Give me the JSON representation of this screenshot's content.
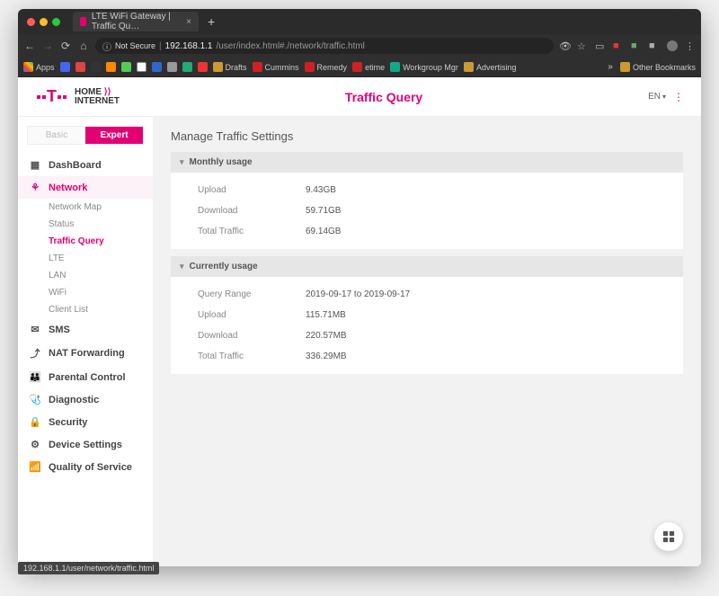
{
  "browser": {
    "tab_title": "LTE WiFi Gateway | Traffic Qu…",
    "url_prefix_insecure": "Not Secure",
    "url_host": "192.168.1.1",
    "url_path": "/user/index.html#./network/traffic.html",
    "bookmarks": {
      "apps": "Apps",
      "drafts": "Drafts",
      "cummins": "Cummins",
      "remedy": "Remedy",
      "etime": "etime",
      "workgroup": "Workgroup Mgr",
      "advertising": "Advertising",
      "other": "Other Bookmarks"
    },
    "status_text": "192.168.1.1/user/network/traffic.html"
  },
  "header": {
    "brand_line1": "HOME",
    "brand_line2": "INTERNET",
    "title": "Traffic Query",
    "lang": "EN"
  },
  "sidebar": {
    "mode_basic": "Basic",
    "mode_expert": "Expert",
    "items": [
      {
        "label": "DashBoard",
        "icon": "grid"
      },
      {
        "label": "Network",
        "icon": "network",
        "active": true,
        "subs": [
          {
            "label": "Network Map"
          },
          {
            "label": "Status"
          },
          {
            "label": "Traffic Query",
            "active": true
          },
          {
            "label": "LTE"
          },
          {
            "label": "LAN"
          },
          {
            "label": "WiFi"
          },
          {
            "label": "Client List"
          }
        ]
      },
      {
        "label": "SMS",
        "icon": "mail"
      },
      {
        "label": "NAT Forwarding",
        "icon": "share"
      },
      {
        "label": "Parental Control",
        "icon": "users"
      },
      {
        "label": "Diagnostic",
        "icon": "steth"
      },
      {
        "label": "Security",
        "icon": "lock"
      },
      {
        "label": "Device Settings",
        "icon": "gear"
      },
      {
        "label": "Quality of Service",
        "icon": "qos"
      }
    ]
  },
  "main": {
    "title": "Manage Traffic Settings",
    "monthly": {
      "header": "Monthly usage",
      "upload_label": "Upload",
      "upload_value": "9.43GB",
      "download_label": "Download",
      "download_value": "59.71GB",
      "total_label": "Total Traffic",
      "total_value": "69.14GB"
    },
    "current": {
      "header": "Currently usage",
      "range_label": "Query Range",
      "range_value": "2019-09-17 to 2019-09-17",
      "upload_label": "Upload",
      "upload_value": "115.71MB",
      "download_label": "Download",
      "download_value": "220.57MB",
      "total_label": "Total Traffic",
      "total_value": "336.29MB"
    }
  }
}
